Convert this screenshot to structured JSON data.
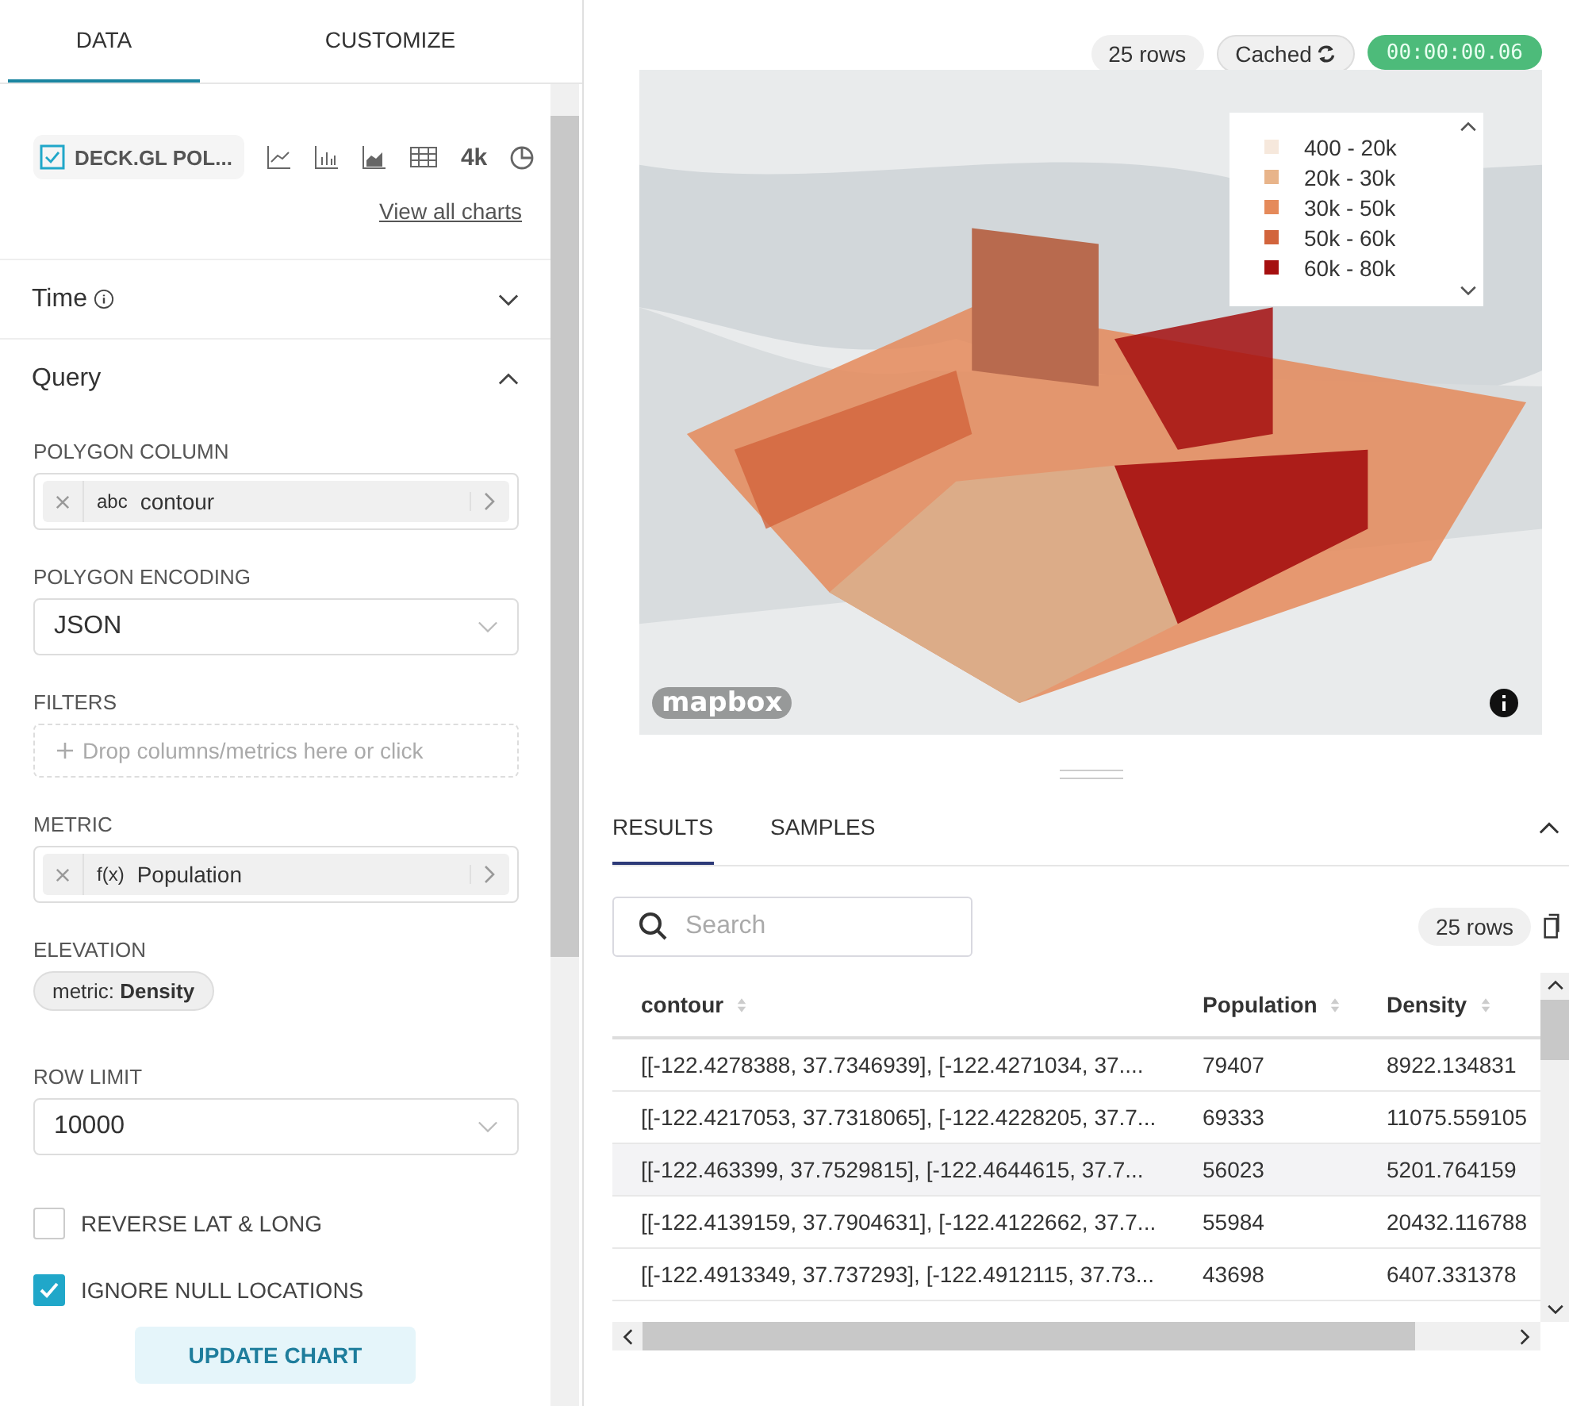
{
  "tabs": [
    {
      "label": "DATA",
      "selected": true
    },
    {
      "label": "CUSTOMIZE",
      "selected": false
    }
  ],
  "chart_picker": {
    "current": "DECK.GL POL...",
    "big_number": "4k",
    "view_all": "View all charts"
  },
  "sections": [
    {
      "title": "Time",
      "expanded": false,
      "info": true
    },
    {
      "title": "Query",
      "expanded": true,
      "info": false
    }
  ],
  "controls": [
    {
      "kind": "column",
      "label": "POLYGON COLUMN",
      "type": "abc",
      "value": "contour"
    },
    {
      "kind": "select",
      "label": "POLYGON ENCODING",
      "value": "JSON"
    },
    {
      "kind": "drop",
      "label": "FILTERS",
      "placeholder": "Drop columns/metrics here or click"
    },
    {
      "kind": "column",
      "label": "METRIC",
      "type": "f(x)",
      "value": "Population"
    },
    {
      "kind": "pill",
      "label": "ELEVATION",
      "prefix": "metric:",
      "value": "Density"
    },
    {
      "kind": "select",
      "label": "ROW LIMIT",
      "value": "10000"
    },
    {
      "kind": "checkbox",
      "label": "REVERSE LAT & LONG",
      "checked": false
    },
    {
      "kind": "checkbox",
      "label": "IGNORE NULL LOCATIONS",
      "checked": true
    }
  ],
  "update_button": "UPDATE CHART",
  "header": {
    "rows": "25 rows",
    "cached": "Cached",
    "timer": "00:00:00.06"
  },
  "map": {
    "legend": [
      {
        "label": "400 - 20k",
        "color": "#f6e8dc"
      },
      {
        "label": "20k - 30k",
        "color": "#e8b48a"
      },
      {
        "label": "30k - 50k",
        "color": "#e58a5a"
      },
      {
        "label": "50k - 60k",
        "color": "#d2643c"
      },
      {
        "label": "60k - 80k",
        "color": "#a50f0f"
      }
    ],
    "attribution": "mapbox"
  },
  "results_tabs": [
    {
      "label": "RESULTS",
      "selected": true
    },
    {
      "label": "SAMPLES",
      "selected": false
    }
  ],
  "search": {
    "placeholder": "Search"
  },
  "row_count": "25 rows",
  "table": {
    "columns": [
      "contour",
      "Population",
      "Density"
    ],
    "rows": [
      {
        "cells": [
          "[[-122.4278388, 37.7346939], [-122.4271034, 37....",
          "79407",
          "8922.134831"
        ],
        "selected": false
      },
      {
        "cells": [
          "[[-122.4217053, 37.7318065], [-122.4228205, 37.7...",
          "69333",
          "11075.559105"
        ],
        "selected": false
      },
      {
        "cells": [
          "[[-122.463399, 37.7529815], [-122.4644615, 37.7...",
          "56023",
          "5201.764159"
        ],
        "selected": true
      },
      {
        "cells": [
          "[[-122.4139159, 37.7904631], [-122.4122662, 37.7...",
          "55984",
          "20432.116788"
        ],
        "selected": false
      },
      {
        "cells": [
          "[[-122.4913349, 37.737293], [-122.4912115, 37.73...",
          "43698",
          "6407.331378"
        ],
        "selected": false
      }
    ]
  }
}
